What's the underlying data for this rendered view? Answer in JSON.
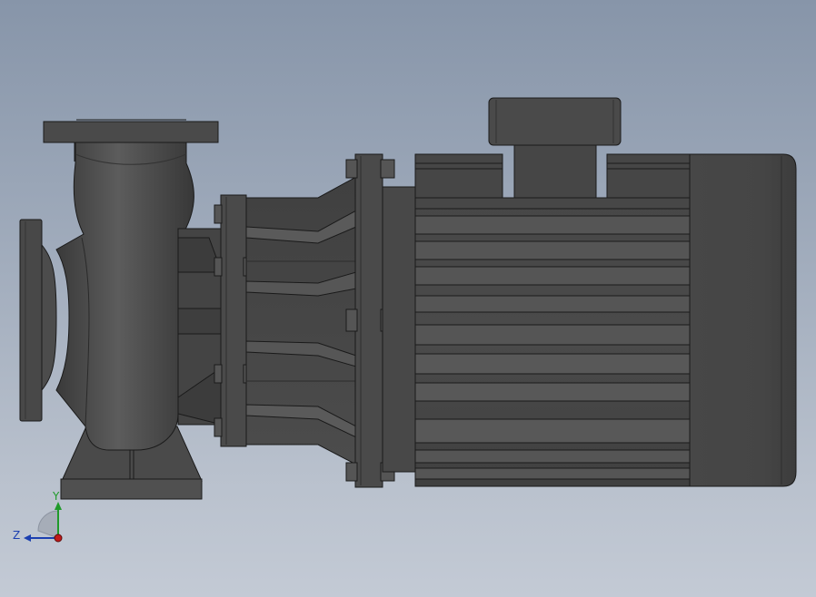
{
  "viewport": {
    "background_top": "#8795a9",
    "background_bottom": "#c3cad5"
  },
  "model": {
    "body_color": "#454545",
    "edge_color": "#1a1a1a",
    "highlight_color": "#6a6a6a"
  },
  "triad": {
    "y_label": "Y",
    "z_label": "Z",
    "y_color": "#1f9a2a",
    "z_color": "#1b3fb0",
    "origin_color": "#c21a1a"
  }
}
